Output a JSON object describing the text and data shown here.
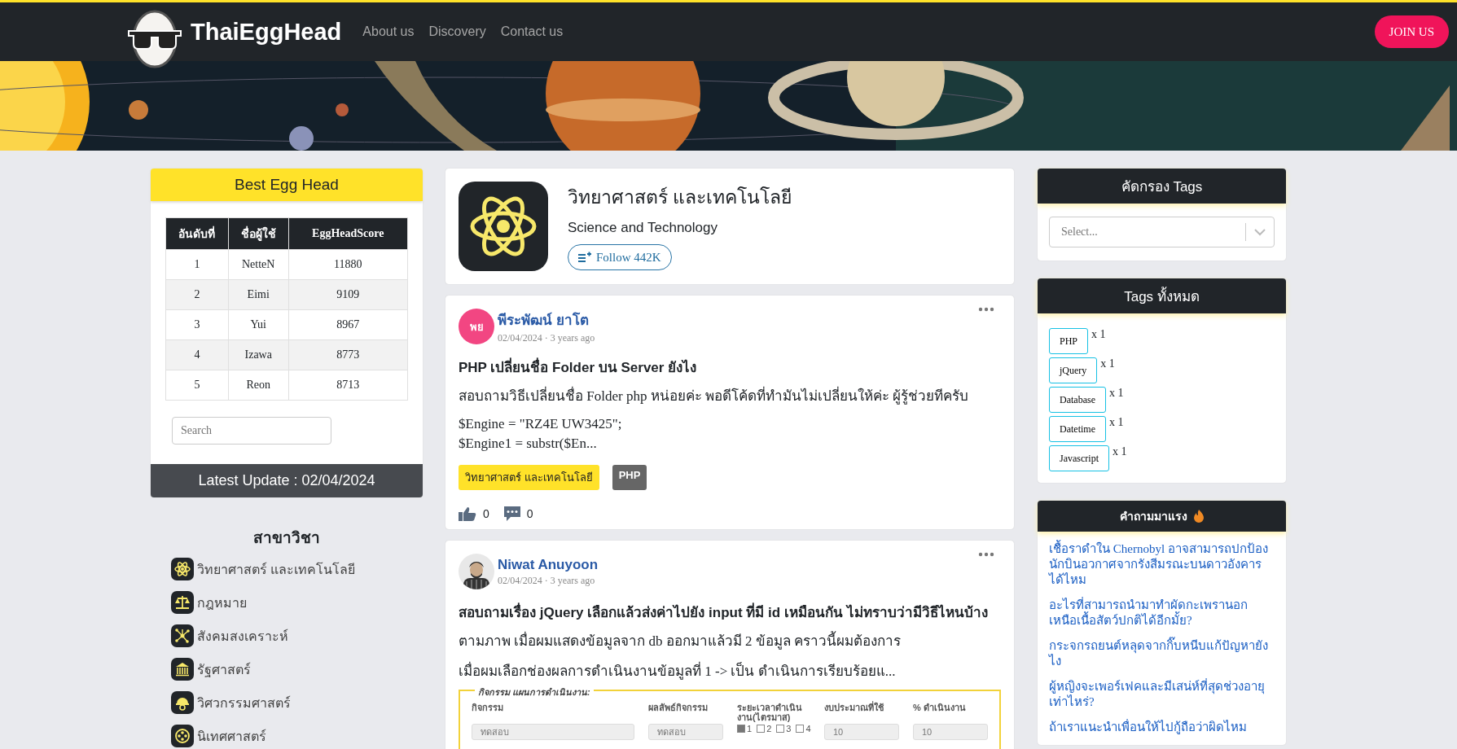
{
  "header": {
    "logo_text": "ThaiEggHead",
    "nav": [
      {
        "label": "About us"
      },
      {
        "label": "Discovery"
      },
      {
        "label": "Contact us"
      }
    ],
    "join_button": "JOIN US"
  },
  "banner": {
    "kind": "picture"
  },
  "best_egg_head": {
    "title": "Best Egg Head",
    "columns": [
      "อันดับที่",
      "ชื่อผู้ใช้",
      "EggHeadScore"
    ],
    "rows": [
      [
        "1",
        "NetteN",
        "11880"
      ],
      [
        "2",
        "Eimi",
        "9109"
      ],
      [
        "3",
        "Yui",
        "8967"
      ],
      [
        "4",
        "Izawa",
        "8773"
      ],
      [
        "5",
        "Reon",
        "8713"
      ]
    ],
    "search_placeholder": "Search",
    "latest_update": "Latest Update : 02/04/2024"
  },
  "subjects": {
    "title": "สาขาวิชา",
    "items": [
      {
        "label": "วิทยาศาสตร์ และเทคโนโลยี"
      },
      {
        "label": "กฎหมาย"
      },
      {
        "label": "สังคมสงเคราะห์"
      },
      {
        "label": "รัฐศาสตร์"
      },
      {
        "label": "วิศวกรรมศาสตร์"
      },
      {
        "label": "นิเทศศาสตร์"
      }
    ]
  },
  "category": {
    "title": "วิทยาศาสตร์ และเทคโนโลยี",
    "subtitle": "Science and Technology",
    "follow_button": "Follow 442K"
  },
  "posts": [
    {
      "avatar": {
        "kind": "initials",
        "text": "พย"
      },
      "author": "พีระพัฒน์ ยาโต",
      "date": "02/04/2024 · 3 years ago",
      "title": "PHP เปลี่ยนชื่อ Folder บน Server ยังไง",
      "body": [
        "สอบถามวิธีเปลี่ยนชื่อ Folder php หน่อยค่ะ พอดีโค้ดที่ทำมันไม่เปลี่ยนให้ค่ะ ผู้รู้ช่วยทีครับ"
      ],
      "code": [
        "$Engine = \"RZ4E UW3425\";",
        "$Engine1 = substr($En..."
      ],
      "tags": [
        {
          "label": "วิทยาศาสตร์ และเทคโนโลยี",
          "kind": "category"
        },
        {
          "label": "PHP",
          "kind": "tag"
        }
      ],
      "likes": "0",
      "comments": "0"
    },
    {
      "avatar": {
        "kind": "picture"
      },
      "author": "Niwat Anuyoon",
      "date": "02/04/2024 · 3 years ago",
      "title": "สอบถามเรื่อง jQuery เลือกแล้วส่งค่าไปยัง input ที่มี id เหมือนกัน ไม่ทราบว่ามีวิธีไหนบ้าง",
      "body": [
        "ตามภาพ เมื่อผมแสดงข้อมูลจาก db ออกมาแล้วมี 2 ข้อมูล คราวนี้ผมต้องการ",
        "เมื่อผมเลือกช่องผลการดำเนินงานข้อมูลที่ 1 -> เป็น ดำเนินการเรียบร้อยแ..."
      ],
      "attachment": {
        "legend": "กิจกรรม แผนการดำเนินงาน:",
        "fields": [
          {
            "kind": "input",
            "label": "กิจกรรม",
            "value": "ทดสอบ"
          },
          {
            "kind": "input",
            "label": "ผลลัพธ์กิจกรรม",
            "value": "ทดสอบ"
          },
          {
            "kind": "checkboxes",
            "label": "ระยะเวลาดำเนินงาน(ไตรมาส)",
            "options": [
              {
                "label": "1",
                "checked": true
              },
              {
                "label": "2",
                "checked": false
              },
              {
                "label": "3",
                "checked": false
              },
              {
                "label": "4",
                "checked": false
              }
            ]
          },
          {
            "kind": "input",
            "label": "งบประมาณที่ใช้",
            "value": "10"
          },
          {
            "kind": "input",
            "label": "% ดำเนินงาน",
            "value": "10"
          }
        ]
      }
    }
  ],
  "tag_filter": {
    "title": "คัดกรอง Tags",
    "placeholder": "Select..."
  },
  "all_tags": {
    "title": "Tags ทั้งหมด",
    "tags": [
      {
        "label": "PHP",
        "count": "x 1"
      },
      {
        "label": "jQuery",
        "count": "x 1"
      },
      {
        "label": "Database",
        "count": "x 1"
      },
      {
        "label": "Datetime",
        "count": "x 1"
      },
      {
        "label": "Javascript",
        "count": "x 1"
      }
    ]
  },
  "hot_questions": {
    "title": "คำถามมาแรง",
    "items": [
      "เชื้อราดำใน Chernobyl อาจสามารถปกป้องนักบินอวกาศจากรังสีมรณะบนดาวอังคารได้ไหม",
      "อะไรที่สามารถนำมาทำผัดกะเพรานอกเหนือเนื้อสัตว์ปกติได้อีกมั้ย?",
      "กระจกรถยนต์หลุดจากกิ๊บหนีบแก้ปัญหายังไง",
      "ผู้หญิงจะเพอร์เฟคและมีเสน่ห์ที่สุดช่วงอายุเท่าไหร่?",
      "ถ้าเราแนะนำเพื่อนให้ไปกู้ถือว่าผิดไหม"
    ]
  }
}
